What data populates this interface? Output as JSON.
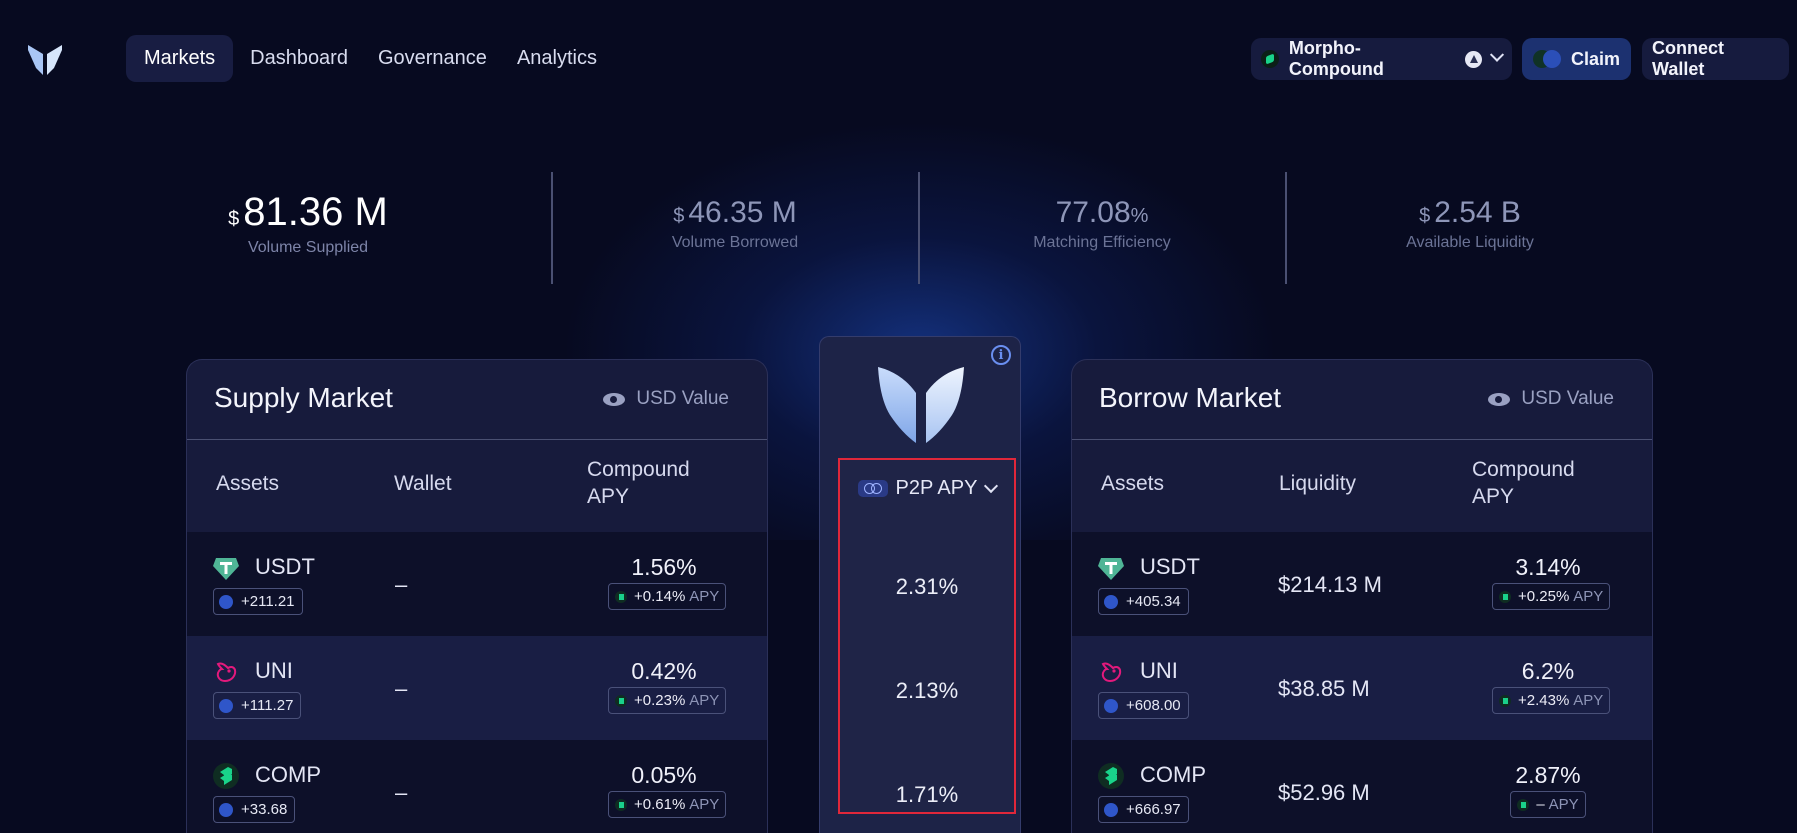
{
  "nav": {
    "items": [
      {
        "label": "Markets",
        "active": true
      },
      {
        "label": "Dashboard",
        "active": false
      },
      {
        "label": "Governance",
        "active": false
      },
      {
        "label": "Analytics",
        "active": false
      }
    ]
  },
  "header": {
    "network_label": "Morpho-Compound",
    "claim_label": "Claim",
    "connect_label": "Connect Wallet"
  },
  "stats": [
    {
      "currency": "$",
      "value": "81.36 M",
      "label": "Volume Supplied"
    },
    {
      "currency": "$",
      "value": "46.35 M",
      "label": "Volume Borrowed"
    },
    {
      "currency": "",
      "value": "77.08",
      "unit": "%",
      "label": "Matching Efficiency"
    },
    {
      "currency": "$",
      "value": "2.54 B",
      "label": "Available Liquidity"
    }
  ],
  "supply": {
    "title": "Supply Market",
    "usd_label": "USD Value",
    "col_assets": "Assets",
    "col_wallet": "Wallet",
    "col_apy_1": "Compound",
    "col_apy_2": "APY",
    "rows": [
      {
        "asset": "USDT",
        "reward": "+211.21",
        "wallet": "–",
        "apy": "1.56%",
        "bonus": "+0.14%",
        "apy_unit": "APY"
      },
      {
        "asset": "UNI",
        "reward": "+111.27",
        "wallet": "–",
        "apy": "0.42%",
        "bonus": "+0.23%",
        "apy_unit": "APY"
      },
      {
        "asset": "COMP",
        "reward": "+33.68",
        "wallet": "–",
        "apy": "0.05%",
        "bonus": "+0.61%",
        "apy_unit": "APY"
      }
    ]
  },
  "center": {
    "info": "i",
    "p2p_label": "P2P APY",
    "values": [
      "2.31%",
      "2.13%",
      "1.71%"
    ]
  },
  "borrow": {
    "title": "Borrow Market",
    "usd_label": "USD Value",
    "col_assets": "Assets",
    "col_liquidity": "Liquidity",
    "col_apy_1": "Compound",
    "col_apy_2": "APY",
    "rows": [
      {
        "asset": "USDT",
        "reward": "+405.34",
        "liquidity": "$214.13 M",
        "apy": "3.14%",
        "bonus": "+0.25%",
        "apy_unit": "APY"
      },
      {
        "asset": "UNI",
        "reward": "+608.00",
        "liquidity": "$38.85 M",
        "apy": "6.2%",
        "bonus": "+2.43%",
        "apy_unit": "APY"
      },
      {
        "asset": "COMP",
        "reward": "+666.97",
        "liquidity": "$52.96 M",
        "apy": "2.87%",
        "bonus": "–",
        "apy_unit": "APY"
      }
    ]
  },
  "colors": {
    "background": "#070a20",
    "panel": "#171b3c",
    "accent_green": "#19d38a",
    "accent_blue": "#2f56c9",
    "highlight_red": "#e0273a"
  },
  "icons": {
    "logo": "morpho-butterfly-logo",
    "usdt": "tether-icon",
    "uni": "uniswap-unicorn-icon",
    "comp": "compound-icon"
  }
}
